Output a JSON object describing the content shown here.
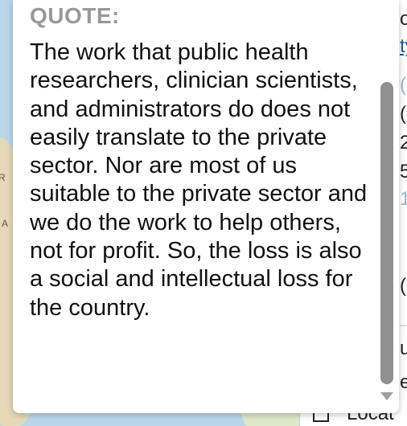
{
  "popup": {
    "label": "QUOTE:",
    "text": "The work that public health researchers, clinician scientists, and administrators do does not easily translate to the private sector. Nor are most of us suitable to the private sector and we do the work to help others, not for profit. So, the loss is also a social and intellectual loss for the country."
  },
  "map": {
    "labels": [
      "R",
      "A"
    ]
  },
  "side_panel": {
    "fragments": [
      "o",
      "ty",
      "(",
      "2",
      "5",
      "1",
      "(",
      "u",
      "e"
    ],
    "legend_item": "Locat"
  },
  "colors": {
    "popup_bg": "#ffffff",
    "label": "#999999",
    "text": "#111111",
    "scroll_thumb": "#909090"
  }
}
